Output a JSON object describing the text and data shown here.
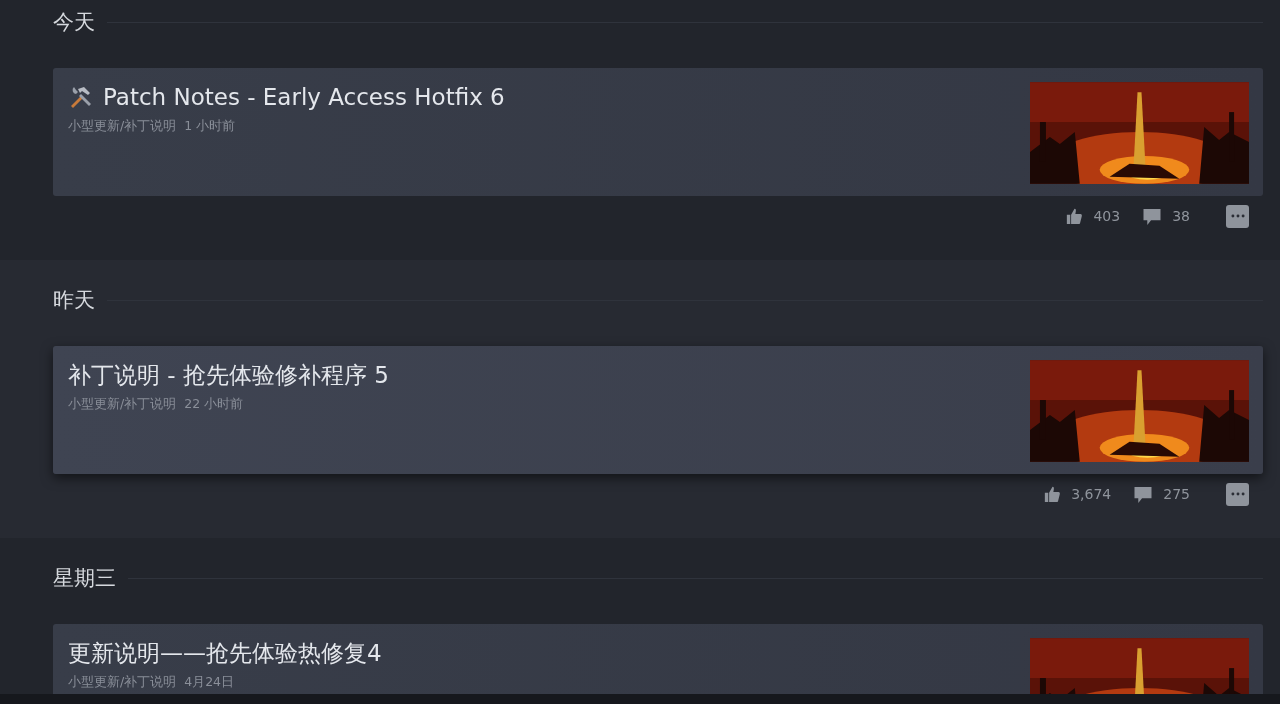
{
  "sections": [
    {
      "heading": "今天",
      "posts": [
        {
          "title": "Patch Notes - Early Access Hotfix 6",
          "tool_icon": true,
          "category": "小型更新/补丁说明",
          "time": "1 小时前",
          "highlighted": false,
          "likes": "403",
          "comments": "38"
        }
      ]
    },
    {
      "heading": "昨天",
      "posts": [
        {
          "title": "补丁说明 - 抢先体验修补程序 5",
          "tool_icon": false,
          "category": "小型更新/补丁说明",
          "time": "22 小时前",
          "highlighted": true,
          "likes": "3,674",
          "comments": "275"
        }
      ]
    },
    {
      "heading": "星期三",
      "posts": [
        {
          "title": "更新说明——抢先体验热修复4",
          "tool_icon": false,
          "category": "小型更新/补丁说明",
          "time": "4月24日",
          "highlighted": false
        }
      ]
    }
  ]
}
